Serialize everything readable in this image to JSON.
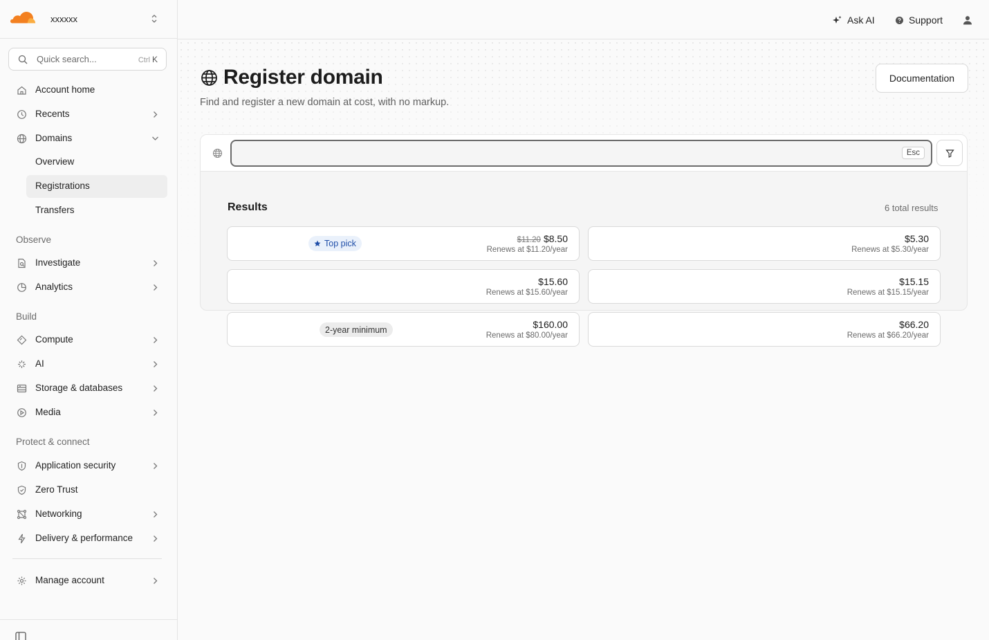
{
  "account": {
    "name": "xxxxxx"
  },
  "search": {
    "placeholder": "Quick search...",
    "shortcut_prefix": "Ctrl",
    "shortcut_key": "K"
  },
  "nav": {
    "account_home": "Account home",
    "recents": "Recents",
    "domains": "Domains",
    "domains_sub": [
      "Overview",
      "Registrations",
      "Transfers"
    ],
    "sections": [
      "Observe",
      "Build",
      "Protect & connect"
    ],
    "observe": [
      "Investigate",
      "Analytics"
    ],
    "build": [
      "Compute",
      "AI",
      "Storage & databases",
      "Media"
    ],
    "protect": [
      "Application security",
      "Zero Trust",
      "Networking",
      "Delivery & performance"
    ],
    "manage": "Manage account"
  },
  "topbar": {
    "ask_ai": "Ask AI",
    "support": "Support"
  },
  "page": {
    "title": "Register domain",
    "subtitle": "Find and register a new domain at cost, with no markup.",
    "documentation": "Documentation"
  },
  "domain_search": {
    "value": "",
    "esc_label": "Esc"
  },
  "results": {
    "title": "Results",
    "count": "6 total results",
    "items": [
      {
        "badge": "Top pick",
        "old_price": "$11.20",
        "price": "$8.50",
        "renews": "Renews at $11.20/year"
      },
      {
        "price": "$5.30",
        "renews": "Renews at $5.30/year"
      },
      {
        "price": "$15.60",
        "renews": "Renews at $15.60/year"
      },
      {
        "price": "$15.15",
        "renews": "Renews at $15.15/year"
      },
      {
        "badge": "2-year minimum",
        "price": "$160.00",
        "renews": "Renews at $80.00/year"
      },
      {
        "price": "$66.20",
        "renews": "Renews at $66.20/year"
      }
    ]
  },
  "colors": {
    "brand_orange": "#f38020",
    "accent_blue": "#1f4ea8"
  }
}
